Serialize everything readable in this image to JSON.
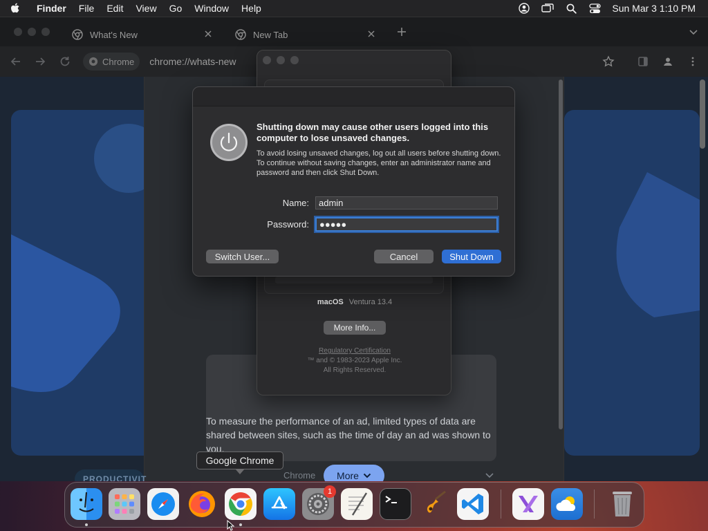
{
  "menubar": {
    "app_name": "Finder",
    "items": [
      "File",
      "Edit",
      "View",
      "Go",
      "Window",
      "Help"
    ],
    "clock": "Sun Mar 3  1:10 PM"
  },
  "browser": {
    "tabs": [
      {
        "label": "What's New"
      },
      {
        "label": "New Tab"
      }
    ],
    "omnibox": {
      "chip_label": "Chrome",
      "url": "chrome://whats-new"
    },
    "page": {
      "promo_text": "To measure the performance of an ad, limited types of data are shared between sites, such as the time of day an ad was shown to you.",
      "category_chip": "PRODUCTIVIT",
      "faded_label": "Chrome",
      "more_button": "More"
    }
  },
  "about_mac": {
    "os_name": "macOS",
    "os_version": "Ventura 13.4",
    "more_info_button": "More Info...",
    "regulatory_link": "Regulatory Certification",
    "copyright": "™ and © 1983-2023 Apple Inc.",
    "rights": "All Rights Reserved."
  },
  "dialog": {
    "title": "Shutting down may cause other users logged into this computer to lose unsaved changes.",
    "body": "To avoid losing unsaved changes, log out all users before shutting down. To continue without saving changes, enter an administrator name and password and then click Shut Down.",
    "name_label": "Name:",
    "name_value": "admin",
    "password_label": "Password:",
    "password_value": "●●●●●",
    "switch_user_button": "Switch User...",
    "cancel_button": "Cancel",
    "shutdown_button": "Shut Down"
  },
  "tooltip": {
    "text": "Google Chrome"
  },
  "dock": {
    "apps": [
      "finder-icon",
      "launchpad-icon",
      "safari-icon",
      "firefox-icon",
      "chrome-icon",
      "app-store-icon",
      "system-settings-icon",
      "textedit-icon",
      "terminal-icon",
      "garageband-icon",
      "vscode-icon",
      "visual-studio-icon",
      "weather-icon",
      "trash-icon"
    ],
    "settings_badge": "1"
  },
  "colors": {
    "accent": "#2f6fd4",
    "dialog_bg": "#2d2d2f",
    "badge": "#e5392f"
  }
}
